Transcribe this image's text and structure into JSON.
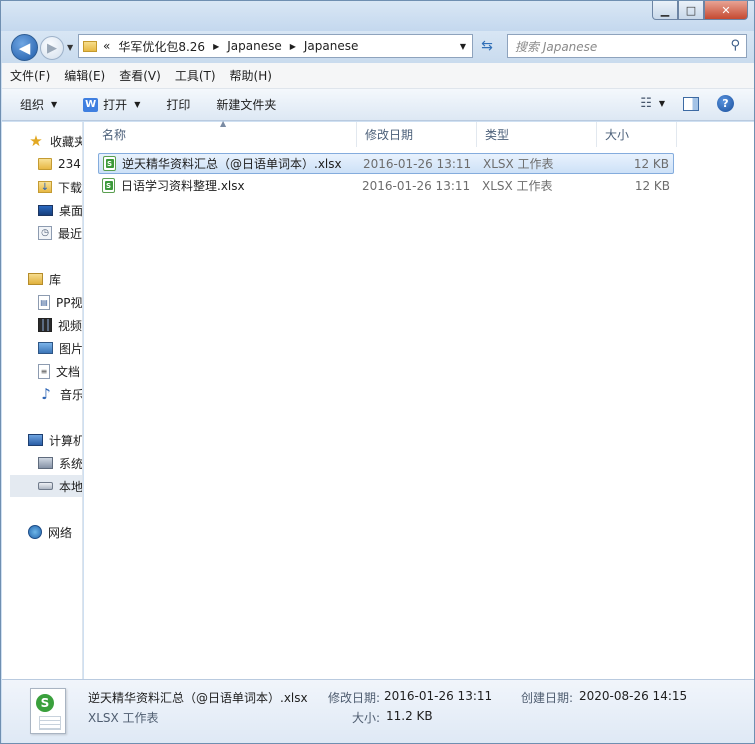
{
  "window": {
    "caption_min": "▁",
    "caption_max": "□",
    "caption_close": "✕"
  },
  "nav": {
    "back_glyph": "◀",
    "forward_glyph": "▶",
    "address": {
      "prefix": "«",
      "crumbs": [
        "华军优化包8.26",
        "Japanese",
        "Japanese"
      ]
    },
    "search_placeholder": "搜索 Japanese"
  },
  "menu": [
    "文件(F)",
    "编辑(E)",
    "查看(V)",
    "工具(T)",
    "帮助(H)"
  ],
  "commands": {
    "organize": "组织",
    "open": "打开",
    "print": "打印",
    "new_folder": "新建文件夹"
  },
  "sidebar": {
    "favorites": [
      {
        "label": "收藏夹",
        "icon": "star-icon"
      },
      {
        "label": "234",
        "icon": "folder-icon"
      },
      {
        "label": "下载",
        "icon": "downloads-icon"
      },
      {
        "label": "桌面",
        "icon": "desktop-icon"
      },
      {
        "label": "最近",
        "icon": "recent-icon"
      }
    ],
    "libraries": [
      {
        "label": "库",
        "icon": "library-icon"
      },
      {
        "label": "PP视",
        "icon": "pp-video-icon"
      },
      {
        "label": "视频",
        "icon": "video-icon"
      },
      {
        "label": "图片",
        "icon": "pictures-icon"
      },
      {
        "label": "文档",
        "icon": "documents-icon"
      },
      {
        "label": "音乐",
        "icon": "music-icon"
      }
    ],
    "computer": [
      {
        "label": "计算机",
        "icon": "computer-icon"
      },
      {
        "label": "系统",
        "icon": "system-drive-icon"
      },
      {
        "label": "本地",
        "icon": "local-drive-icon"
      }
    ],
    "network": [
      {
        "label": "网络",
        "icon": "network-icon"
      }
    ]
  },
  "columns": {
    "name": "名称",
    "date": "修改日期",
    "type": "类型",
    "size": "大小"
  },
  "files": [
    {
      "name": "逆天精华资料汇总（@日语单词本）.xlsx",
      "date": "2016-01-26 13:11",
      "type": "XLSX 工作表",
      "size": "12 KB",
      "selected": true
    },
    {
      "name": "日语学习资料整理.xlsx",
      "date": "2016-01-26 13:11",
      "type": "XLSX 工作表",
      "size": "12 KB",
      "selected": false
    }
  ],
  "details": {
    "name": "逆天精华资料汇总（@日语单词本）.xlsx",
    "type": "XLSX 工作表",
    "modified_label": "修改日期:",
    "modified_value": "2016-01-26 13:11",
    "created_label": "创建日期:",
    "created_value": "2020-08-26 14:15",
    "size_label": "大小:",
    "size_value": "11.2 KB"
  }
}
